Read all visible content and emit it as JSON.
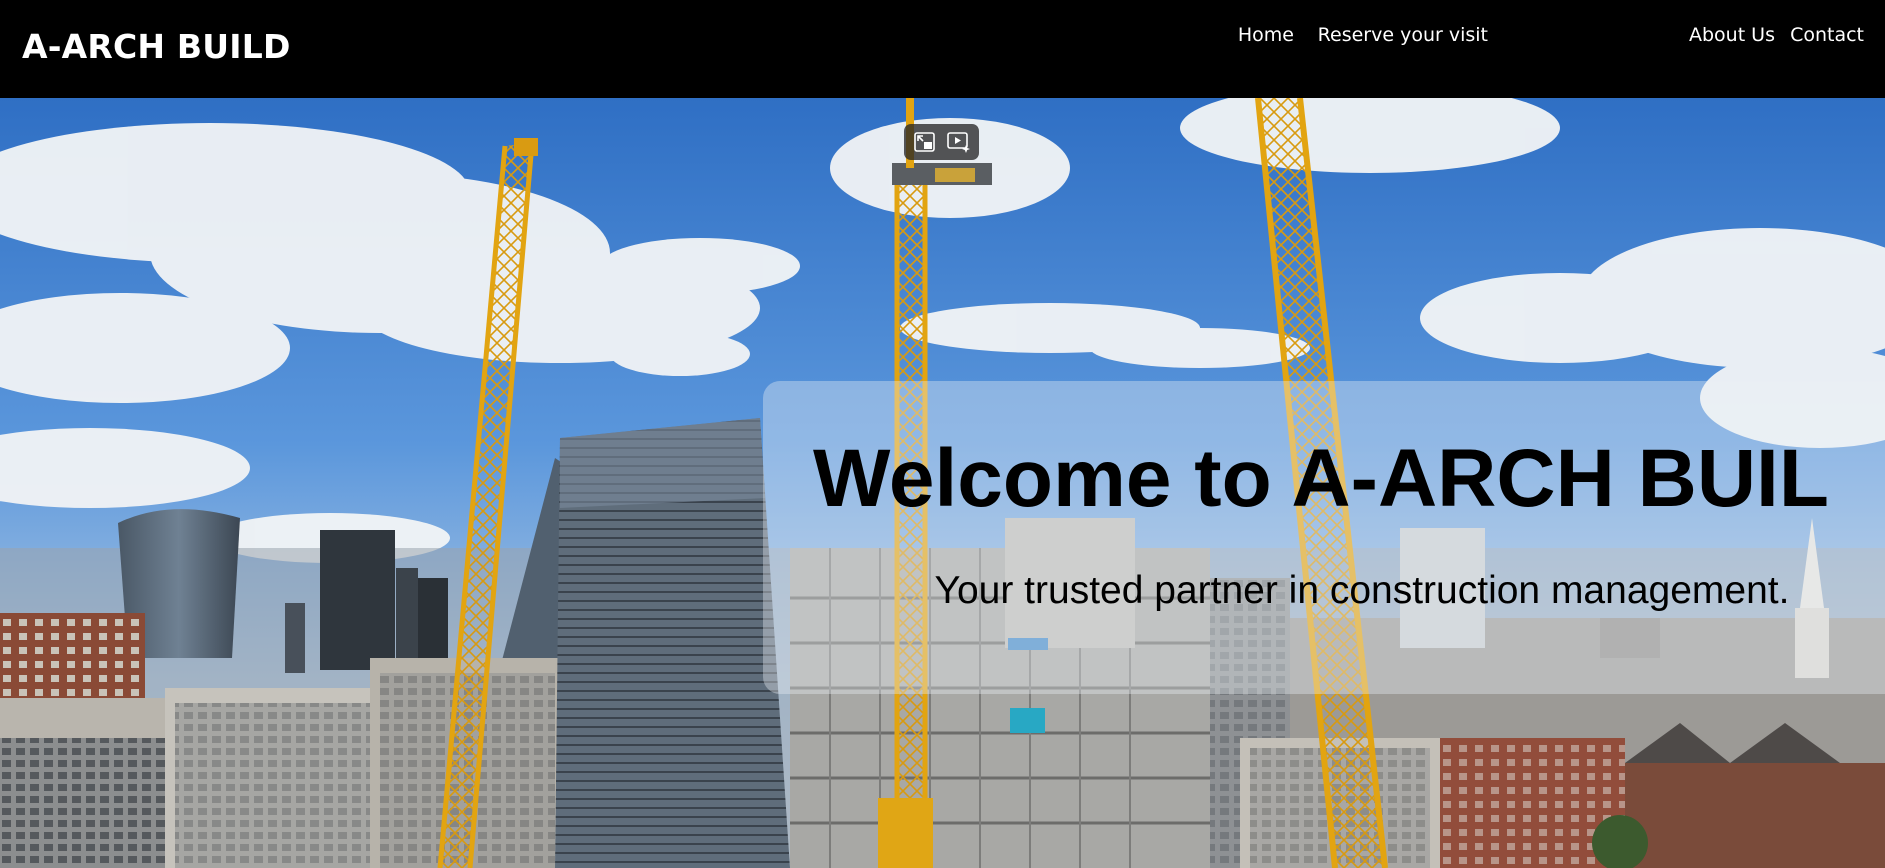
{
  "header": {
    "brand": "A-ARCH BUILD",
    "nav": [
      {
        "label": "Home"
      },
      {
        "label": "Reserve your visit"
      },
      {
        "label": "About Us"
      },
      {
        "label": "Contact"
      }
    ]
  },
  "hero": {
    "title": "Welcome to A-ARCH BUILD",
    "subtitle": "Your trusted partner in construction management.",
    "video_controls": [
      {
        "icon": "minimize-player-icon"
      },
      {
        "icon": "autoplay-icon"
      }
    ]
  },
  "colors": {
    "header_bg": "#000000",
    "nav_text": "#ffffff",
    "sky": "#3f7fd0",
    "crane": "#e8b320",
    "panel": "rgba(235,240,245,0.38)"
  }
}
